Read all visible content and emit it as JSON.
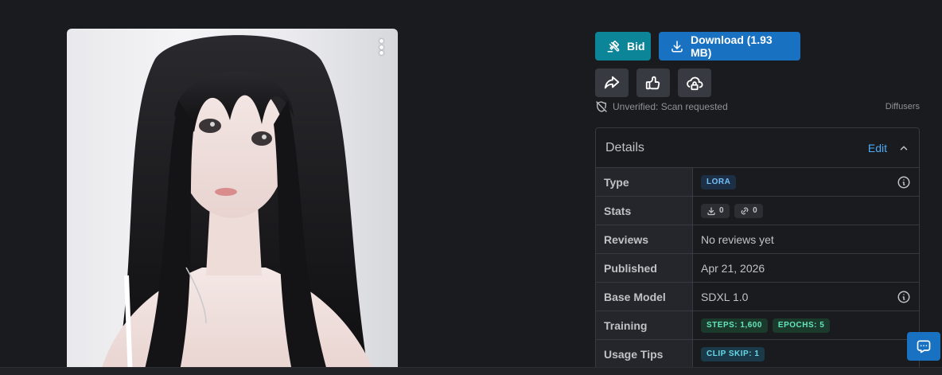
{
  "image": {
    "alt": "Anime-style portrait of a woman with long black hair"
  },
  "actions": {
    "bid_label": "Bid",
    "download_label": "Download (1.93 MB)"
  },
  "icons": {
    "bid": "gavel-icon",
    "download": "download-icon",
    "share": "share-icon",
    "like": "thumb-up-icon",
    "cloud": "cloud-lock-icon",
    "shield": "shield-off-icon",
    "info": "info-icon",
    "chat": "chat-icon"
  },
  "scan": {
    "status": "Unverified: Scan requested",
    "library": "Diffusers"
  },
  "details": {
    "title": "Details",
    "edit_label": "Edit",
    "rows": {
      "type": {
        "label": "Type",
        "badge": "LORA"
      },
      "stats": {
        "label": "Stats",
        "downloads": "0",
        "links": "0"
      },
      "reviews": {
        "label": "Reviews",
        "value": "No reviews yet"
      },
      "published": {
        "label": "Published",
        "value": "Apr 21, 2026"
      },
      "base_model": {
        "label": "Base Model",
        "value": "SDXL 1.0"
      },
      "training": {
        "label": "Training",
        "steps": "STEPS: 1,600",
        "epochs": "EPOCHS: 5"
      },
      "usage_tips": {
        "label": "Usage Tips",
        "clip_skip": "CLIP SKIP: 1"
      }
    }
  },
  "colors": {
    "background": "#1a1b1e",
    "bid": "#0c8599",
    "download": "#1971c2",
    "link": "#4dabf7"
  }
}
